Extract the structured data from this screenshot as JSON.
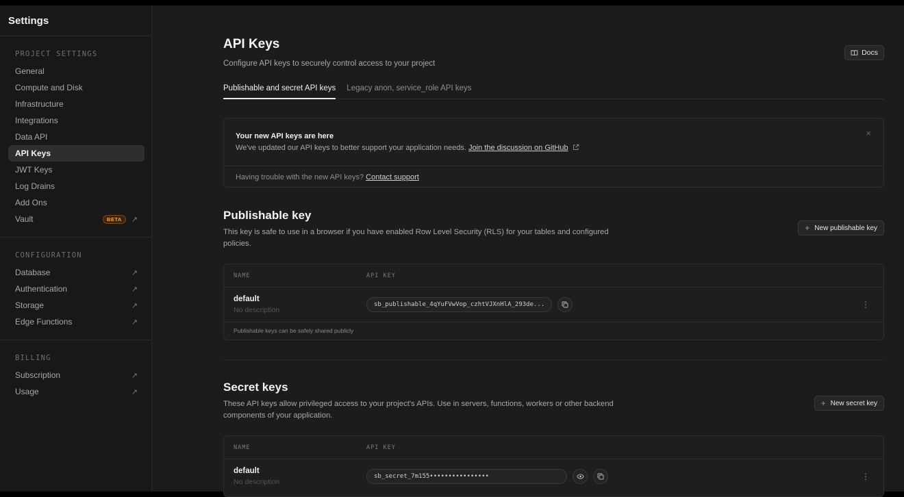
{
  "sidebar": {
    "title": "Settings",
    "sections": [
      {
        "heading": "PROJECT SETTINGS",
        "items": [
          {
            "label": "General"
          },
          {
            "label": "Compute and Disk"
          },
          {
            "label": "Infrastructure"
          },
          {
            "label": "Integrations"
          },
          {
            "label": "Data API"
          },
          {
            "label": "API Keys",
            "active": true
          },
          {
            "label": "JWT Keys"
          },
          {
            "label": "Log Drains"
          },
          {
            "label": "Add Ons"
          },
          {
            "label": "Vault",
            "badge": "BETA",
            "external": true
          }
        ]
      },
      {
        "heading": "CONFIGURATION",
        "items": [
          {
            "label": "Database",
            "external": true
          },
          {
            "label": "Authentication",
            "external": true
          },
          {
            "label": "Storage",
            "external": true
          },
          {
            "label": "Edge Functions",
            "external": true
          }
        ]
      },
      {
        "heading": "BILLING",
        "items": [
          {
            "label": "Subscription",
            "external": true
          },
          {
            "label": "Usage",
            "external": true
          }
        ]
      }
    ]
  },
  "header": {
    "title": "API Keys",
    "subtitle": "Configure API keys to securely control access to your project",
    "docs_label": "Docs",
    "tabs": [
      {
        "label": "Publishable and secret API keys",
        "active": true
      },
      {
        "label": "Legacy anon, service_role API keys"
      }
    ]
  },
  "notice": {
    "title": "Your new API keys are here",
    "text": "We've updated our API keys to better support your application needs.",
    "link": "Join the discussion on GitHub",
    "footer_text": "Having trouble with the new API keys?",
    "footer_link": "Contact support"
  },
  "publishable": {
    "title": "Publishable key",
    "description": "This key is safe to use in a browser if you have enabled Row Level Security (RLS) for your tables and configured policies.",
    "new_button": "New publishable key",
    "columns": [
      "NAME",
      "API KEY"
    ],
    "rows": [
      {
        "name": "default",
        "description": "No description",
        "key": "sb_publishable_4qYuFVwVop_czhtVJXnHlA_293de..."
      }
    ],
    "footer": "Publishable keys can be safely shared publicly"
  },
  "secret": {
    "title": "Secret keys",
    "description": "These API keys allow privileged access to your project's APIs. Use in servers, functions, workers or other backend components of your application.",
    "new_button": "New secret key",
    "columns": [
      "NAME",
      "API KEY"
    ],
    "rows": [
      {
        "name": "default",
        "description": "No description",
        "key": "sb_secret_7m155••••••••••••••••"
      }
    ]
  },
  "colors": {
    "background": "#1c1c1c",
    "sidebar": "#181818",
    "beta_badge": "#f5a04a"
  },
  "icons": {
    "docs": "book-icon",
    "external": "arrow-up-right-icon",
    "close": "close-icon",
    "copy": "copy-icon",
    "reveal": "eye-icon",
    "more": "kebab-menu-icon",
    "add": "plus-icon"
  }
}
